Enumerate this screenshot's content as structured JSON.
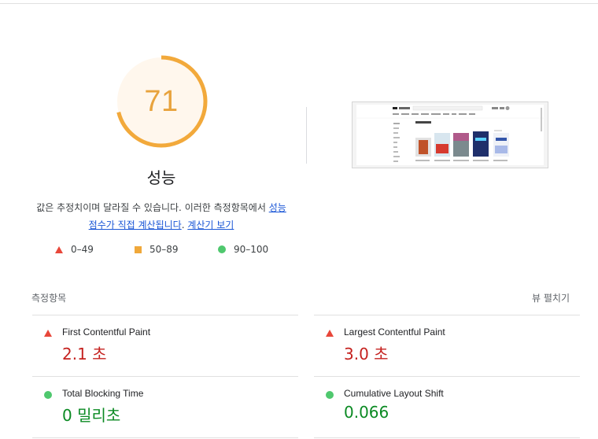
{
  "performance": {
    "score": "71",
    "score_fraction": 0.71,
    "title": "성능",
    "desc_prefix": "값은 추정치이며 달라질 수 있습니다. 이러한 측정항목에서 ",
    "desc_link1": "성능 점수가 직접 계산됩니다",
    "desc_middle": ". ",
    "desc_link2": "계산기 보기",
    "colors": {
      "gauge": "#f2a93b",
      "gauge_bg": "#fff7ed",
      "score_text": "#e8a33d"
    }
  },
  "legend": [
    {
      "icon": "red-triangle-icon",
      "label": "0–49"
    },
    {
      "icon": "orange-square-icon",
      "label": "50–89"
    },
    {
      "icon": "green-circle-icon",
      "label": "90–100"
    }
  ],
  "metrics": {
    "header": "측정항목",
    "expand_label": "뷰 펼치기",
    "items": [
      {
        "name": "First Contentful Paint",
        "value": "2.1 초",
        "status": "red"
      },
      {
        "name": "Largest Contentful Paint",
        "value": "3.0 초",
        "status": "red"
      },
      {
        "name": "Total Blocking Time",
        "value": "0 밀리초",
        "status": "green"
      },
      {
        "name": "Cumulative Layout Shift",
        "value": "0.066",
        "status": "green"
      }
    ]
  }
}
